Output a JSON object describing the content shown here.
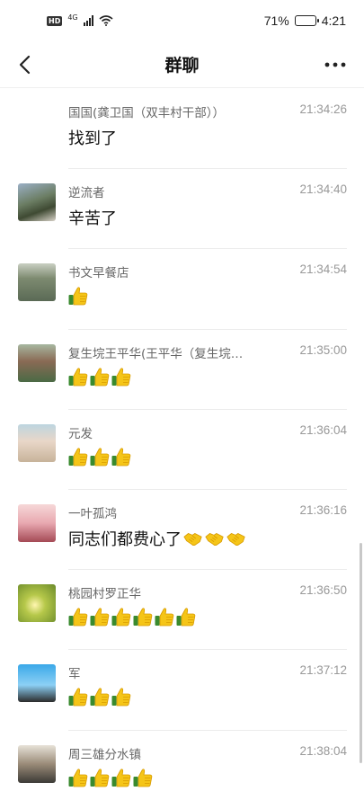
{
  "status_bar": {
    "hd": "HD",
    "network": "4G",
    "battery_text": "71%",
    "battery_level": 0.71,
    "time": "4:21"
  },
  "nav": {
    "title": "群聊",
    "back_icon": "chevron-left-icon",
    "more_icon": "more-dots-icon"
  },
  "messages": [
    {
      "sender": "国国(龚卫国（双丰村干部））",
      "time": "21:34:26",
      "text": "找到了",
      "avatar": false
    },
    {
      "sender": "逆流者",
      "time": "21:34:40",
      "text": "辛苦了",
      "avatar": true
    },
    {
      "sender": "书文早餐店",
      "time": "21:34:54",
      "text": "",
      "thumbs": 1,
      "avatar": true
    },
    {
      "sender": "复生垸王平华(王平华（复生垸…",
      "time": "21:35:00",
      "text": "",
      "thumbs": 3,
      "avatar": true
    },
    {
      "sender": "元发",
      "time": "21:36:04",
      "text": "",
      "thumbs": 3,
      "avatar": true
    },
    {
      "sender": "一叶孤鸿",
      "time": "21:36:16",
      "text": "同志们都费心了",
      "handshakes": 3,
      "avatar": true
    },
    {
      "sender": "桃园村罗正华",
      "time": "21:36:50",
      "text": "",
      "thumbs": 6,
      "avatar": true
    },
    {
      "sender": "军",
      "time": "21:37:12",
      "text": "",
      "thumbs": 3,
      "avatar": true
    },
    {
      "sender": "周三雄分水镇",
      "time": "21:38:04",
      "text": "",
      "thumbs": 4,
      "avatar": true
    }
  ]
}
